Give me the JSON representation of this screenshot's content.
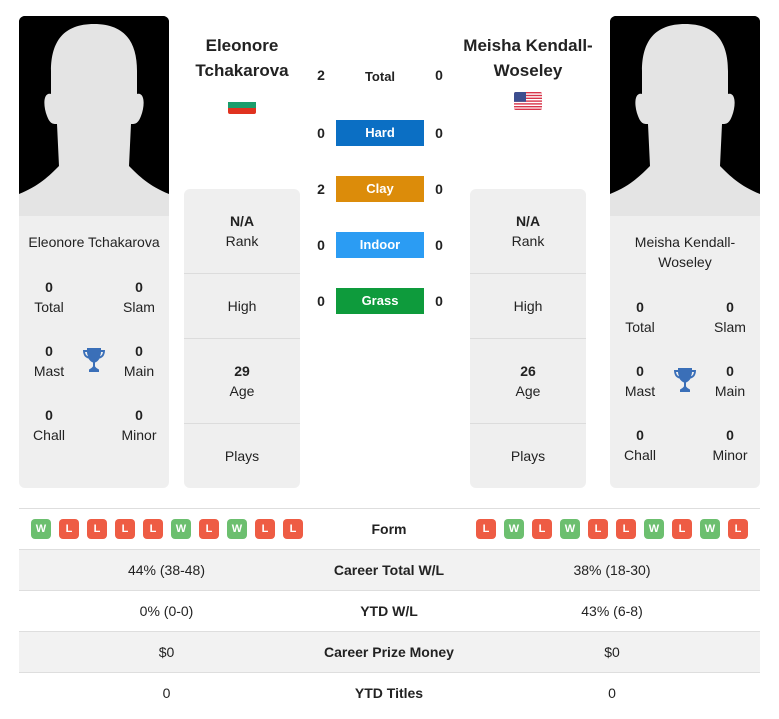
{
  "players": [
    {
      "name": "Eleonore Tchakarova",
      "header_name_lines": [
        "Eleonore",
        "Tchakarova"
      ],
      "card_name_lines": [
        "Eleonore Tchakarova"
      ],
      "flag": "bulgaria-flag",
      "titles": {
        "total": {
          "value": "0",
          "label": "Total"
        },
        "slam": {
          "value": "0",
          "label": "Slam"
        },
        "mast": {
          "value": "0",
          "label": "Mast"
        },
        "main": {
          "value": "0",
          "label": "Main"
        },
        "chall": {
          "value": "0",
          "label": "Chall"
        },
        "minor": {
          "value": "0",
          "label": "Minor"
        }
      },
      "info": {
        "rank_value": "N/A",
        "rank_label": "Rank",
        "high_label": "High",
        "age_value": "29",
        "age_label": "Age",
        "plays_label": "Plays"
      },
      "form": [
        "W",
        "L",
        "L",
        "L",
        "L",
        "W",
        "L",
        "W",
        "L",
        "L"
      ]
    },
    {
      "name": "Meisha Kendall-Woseley",
      "header_name_lines": [
        "Meisha Kendall-",
        "Woseley"
      ],
      "card_name_lines": [
        "Meisha Kendall-",
        "Woseley"
      ],
      "flag": "usa-flag",
      "titles": {
        "total": {
          "value": "0",
          "label": "Total"
        },
        "slam": {
          "value": "0",
          "label": "Slam"
        },
        "mast": {
          "value": "0",
          "label": "Mast"
        },
        "main": {
          "value": "0",
          "label": "Main"
        },
        "chall": {
          "value": "0",
          "label": "Chall"
        },
        "minor": {
          "value": "0",
          "label": "Minor"
        }
      },
      "info": {
        "rank_value": "N/A",
        "rank_label": "Rank",
        "high_label": "High",
        "age_value": "26",
        "age_label": "Age",
        "plays_label": "Plays"
      },
      "form": [
        "L",
        "W",
        "L",
        "W",
        "L",
        "L",
        "W",
        "L",
        "W",
        "L"
      ]
    }
  ],
  "surfaces": [
    {
      "label": "Total",
      "left": "2",
      "right": "0",
      "color": null
    },
    {
      "label": "Hard",
      "left": "0",
      "right": "0",
      "color": "#0b6fc4"
    },
    {
      "label": "Clay",
      "left": "2",
      "right": "0",
      "color": "#dc8c0a"
    },
    {
      "label": "Indoor",
      "left": "0",
      "right": "0",
      "color": "#2b9cf3"
    },
    {
      "label": "Grass",
      "left": "0",
      "right": "0",
      "color": "#0e9b3c"
    }
  ],
  "comparison": {
    "form_label": "Form",
    "rows": [
      {
        "label": "Career Total W/L",
        "left": "44% (38-48)",
        "right": "38% (18-30)"
      },
      {
        "label": "YTD W/L",
        "left": "0% (0-0)",
        "right": "43% (6-8)"
      },
      {
        "label": "Career Prize Money",
        "left": "$0",
        "right": "$0"
      },
      {
        "label": "YTD Titles",
        "left": "0",
        "right": "0"
      }
    ]
  },
  "colors": {
    "win": "#6cbf6f",
    "loss": "#ee5c44",
    "trophy": "#3a6fb8"
  }
}
